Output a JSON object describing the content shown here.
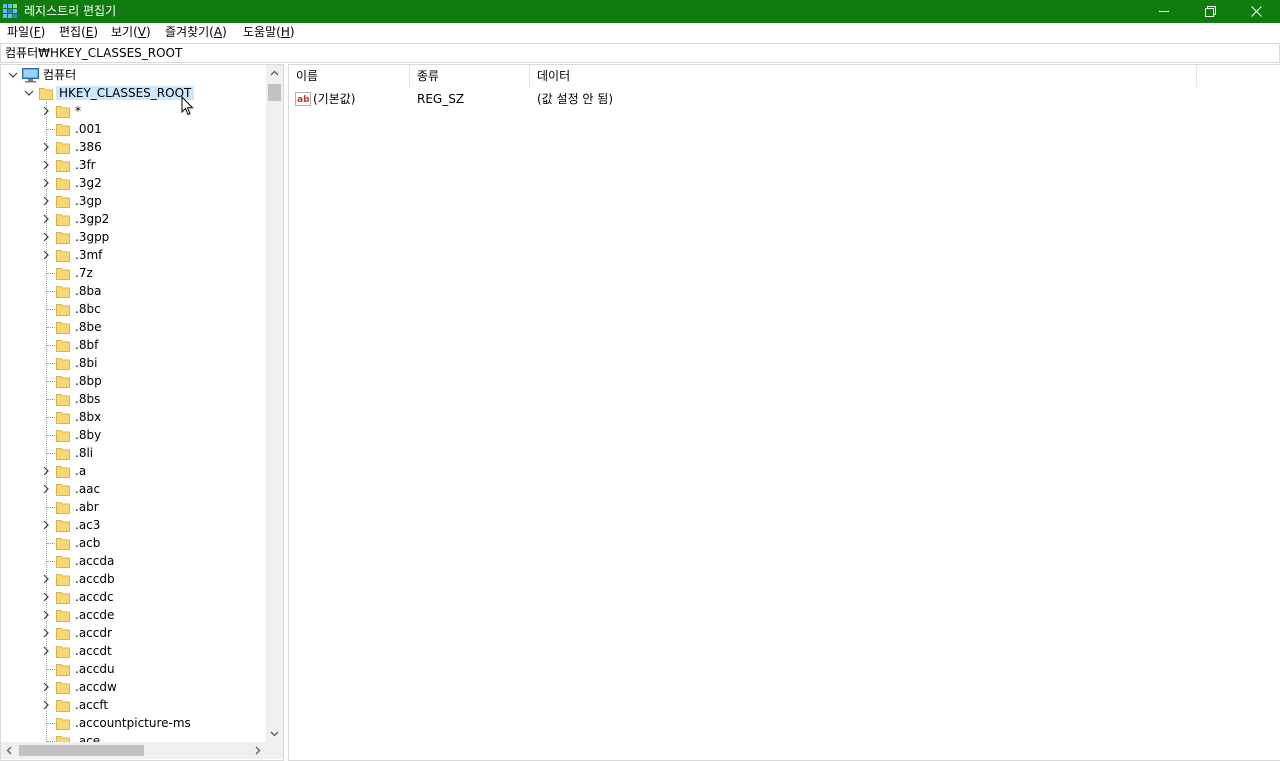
{
  "window": {
    "title": "레지스트리 편집기",
    "titlebar_color": "#107c10",
    "icon": "registry-editor-icon",
    "controls": [
      "minimize-icon",
      "restore-icon",
      "close-icon"
    ]
  },
  "menu": [
    {
      "label": "파일(",
      "accel": "F",
      "suffix": ")"
    },
    {
      "label": "편집(",
      "accel": "E",
      "suffix": ")"
    },
    {
      "label": "보기(",
      "accel": "V",
      "suffix": ")"
    },
    {
      "label": "즐겨찾기(",
      "accel": "A",
      "suffix": ")"
    },
    {
      "label": "도움말(",
      "accel": "H",
      "suffix": ")"
    }
  ],
  "address": "컴퓨터₩HKEY_CLASSES_ROOT",
  "tree": {
    "root": {
      "label": "컴퓨터",
      "icon": "computer-icon",
      "expanded": true
    },
    "hive": {
      "label": "HKEY_CLASSES_ROOT",
      "icon": "folder-icon",
      "expanded": true,
      "selected": true
    },
    "children": [
      {
        "label": "*",
        "has_children": true
      },
      {
        "label": ".001",
        "has_children": false
      },
      {
        "label": ".386",
        "has_children": true
      },
      {
        "label": ".3fr",
        "has_children": true
      },
      {
        "label": ".3g2",
        "has_children": true
      },
      {
        "label": ".3gp",
        "has_children": true
      },
      {
        "label": ".3gp2",
        "has_children": true
      },
      {
        "label": ".3gpp",
        "has_children": true
      },
      {
        "label": ".3mf",
        "has_children": true
      },
      {
        "label": ".7z",
        "has_children": false
      },
      {
        "label": ".8ba",
        "has_children": false
      },
      {
        "label": ".8bc",
        "has_children": false
      },
      {
        "label": ".8be",
        "has_children": false
      },
      {
        "label": ".8bf",
        "has_children": false
      },
      {
        "label": ".8bi",
        "has_children": false
      },
      {
        "label": ".8bp",
        "has_children": false
      },
      {
        "label": ".8bs",
        "has_children": false
      },
      {
        "label": ".8bx",
        "has_children": false
      },
      {
        "label": ".8by",
        "has_children": false
      },
      {
        "label": ".8li",
        "has_children": false
      },
      {
        "label": ".a",
        "has_children": true
      },
      {
        "label": ".aac",
        "has_children": true
      },
      {
        "label": ".abr",
        "has_children": false
      },
      {
        "label": ".ac3",
        "has_children": true
      },
      {
        "label": ".acb",
        "has_children": false
      },
      {
        "label": ".accda",
        "has_children": false
      },
      {
        "label": ".accdb",
        "has_children": true
      },
      {
        "label": ".accdc",
        "has_children": true
      },
      {
        "label": ".accde",
        "has_children": true
      },
      {
        "label": ".accdr",
        "has_children": true
      },
      {
        "label": ".accdt",
        "has_children": true
      },
      {
        "label": ".accdu",
        "has_children": false
      },
      {
        "label": ".accdw",
        "has_children": true
      },
      {
        "label": ".accft",
        "has_children": true
      },
      {
        "label": ".accountpicture-ms",
        "has_children": false
      },
      {
        "label": ".ace",
        "has_children": false
      }
    ]
  },
  "values": {
    "columns": [
      "이름",
      "종류",
      "데이터"
    ],
    "rows": [
      {
        "name": "(기본값)",
        "type": "REG_SZ",
        "data": "(값 설정 안 됨)",
        "icon": "string-value-icon"
      }
    ]
  },
  "colors": {
    "selection": "#cce8ff",
    "folder": "#f8d775",
    "scrollbar_thumb": "#c1c1c1"
  }
}
